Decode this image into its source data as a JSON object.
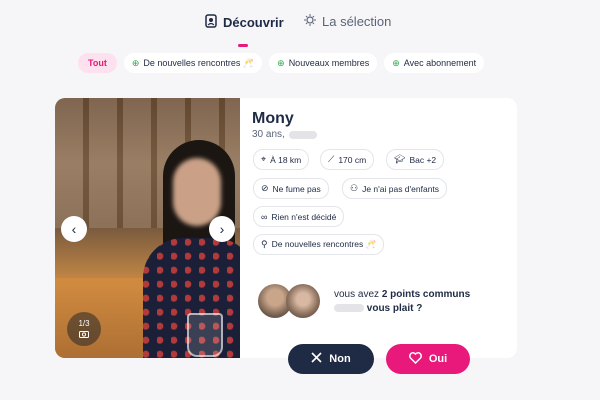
{
  "nav": {
    "tabs": [
      {
        "label": "Découvrir",
        "active": true,
        "icon": "discover-icon"
      },
      {
        "label": "La sélection",
        "active": false,
        "icon": "sparkle-icon"
      }
    ]
  },
  "filters": [
    {
      "label": "Tout",
      "active": true
    },
    {
      "label": "De nouvelles rencontres 🥂",
      "active": false,
      "icon": "badge-icon"
    },
    {
      "label": "Nouveaux membres",
      "active": false,
      "icon": "badge-icon"
    },
    {
      "label": "Avec abonnement",
      "active": false,
      "icon": "badge-icon"
    }
  ],
  "profile": {
    "name": "Mony",
    "age_text": "30 ans,",
    "photo_counter": "1/3",
    "tags": [
      {
        "label": "À 18 km",
        "icon": "location-icon"
      },
      {
        "label": "170 cm",
        "icon": "ruler-icon"
      },
      {
        "label": "Bac +2",
        "icon": "graduation-cap-icon"
      },
      {
        "label": "Ne fume pas",
        "icon": "no-smoking-icon"
      },
      {
        "label": "Je n'ai pas d'enfants",
        "icon": "family-icon"
      },
      {
        "label": "Rien n'est décidé",
        "icon": "rings-icon"
      },
      {
        "label": "De nouvelles rencontres 🥂",
        "icon": "search-icon"
      }
    ]
  },
  "common": {
    "prefix": "vous avez ",
    "highlight": "2 points communs",
    "suffix": "vous plait ?"
  },
  "actions": {
    "no_label": "Non",
    "yes_label": "Oui"
  },
  "colors": {
    "accent": "#e8197a",
    "dark": "#1f2a44",
    "badge_green": "#2aa84a"
  }
}
